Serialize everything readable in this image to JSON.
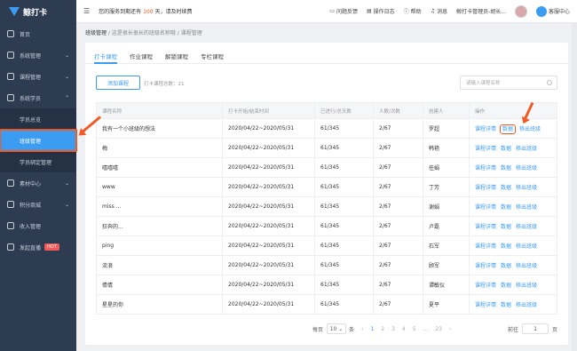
{
  "app": {
    "name": "鲸打卡"
  },
  "topbar": {
    "notice_prefix": "您的服务到期还有",
    "notice_days": "100",
    "notice_suffix": "天，请及时续费",
    "items": [
      "问题反馈",
      "操作日志",
      "帮助",
      "消息"
    ],
    "user": "鲸打卡管理员-胡长...",
    "service": "客服中心"
  },
  "sidebar": {
    "items": [
      {
        "label": "首页"
      },
      {
        "label": "系统管理"
      },
      {
        "label": "课程管理"
      },
      {
        "label": "系统学员"
      }
    ],
    "sub_items": [
      {
        "label": "学员总览"
      },
      {
        "label": "班级管理"
      },
      {
        "label": "学员绑定管理"
      }
    ],
    "items2": [
      {
        "label": "素材中心"
      },
      {
        "label": "积分商城"
      },
      {
        "label": "收入管理"
      },
      {
        "label": "发起直播"
      }
    ],
    "hot": "HOT"
  },
  "breadcrumb": {
    "root": "班级管理",
    "middle": "这是很长很长的班级名称哦",
    "current": "课程管理"
  },
  "tabs": [
    "打卡课程",
    "作业课程",
    "解锁课程",
    "专栏课程"
  ],
  "toolbar": {
    "add_label": "添加课程",
    "count_label": "打卡课程总数：21",
    "search_placeholder": "请输入课程名称"
  },
  "table": {
    "headers": [
      "课程名称",
      "打卡开始/结束时间",
      "已进行/总天数",
      "人数/次数",
      "创建人",
      "操作"
    ],
    "rows": [
      {
        "name": "我有一个小班级的想法",
        "time": "2020/04/22~2020/05/31",
        "days": "61/345",
        "count": "2/67",
        "creator": "罗超"
      },
      {
        "name": "梅",
        "time": "2020/04/22~2020/05/31",
        "days": "61/345",
        "count": "2/67",
        "creator": "韩艳"
      },
      {
        "name": "嘻嘻嘻",
        "time": "2020/04/22~2020/05/31",
        "days": "61/345",
        "count": "2/67",
        "creator": "任娟"
      },
      {
        "name": "www",
        "time": "2020/04/22~2020/05/31",
        "days": "61/345",
        "count": "2/67",
        "creator": "丁芳"
      },
      {
        "name": "miss ...",
        "time": "2020/04/22~2020/05/31",
        "days": "61/345",
        "count": "2/67",
        "creator": "谢娟"
      },
      {
        "name": "狂奔的...",
        "time": "2020/04/22~2020/05/31",
        "days": "61/345",
        "count": "2/67",
        "creator": "卢磊"
      },
      {
        "name": "ping",
        "time": "2020/04/22~2020/05/31",
        "days": "61/345",
        "count": "2/67",
        "creator": "石军"
      },
      {
        "name": "流浪",
        "time": "2020/04/22~2020/05/31",
        "days": "61/345",
        "count": "2/67",
        "creator": "顾军"
      },
      {
        "name": "倩倩",
        "time": "2020/04/22~2020/05/31",
        "days": "61/345",
        "count": "2/67",
        "creator": "谭敏仪"
      },
      {
        "name": "星星的你",
        "time": "2020/04/22~2020/05/31",
        "days": "61/345",
        "count": "2/67",
        "creator": "夏平"
      }
    ],
    "ops": [
      "课程详情",
      "数据",
      "移出班级"
    ]
  },
  "pager": {
    "per_label": "每页",
    "per_value": "10",
    "per_unit": "条",
    "pages": [
      "1",
      "2",
      "3",
      "4",
      "5",
      "...",
      "23"
    ],
    "goto_label": "前往",
    "goto_value": "1",
    "goto_unit": "页"
  },
  "colors": {
    "accent": "#3c9cf2",
    "highlight": "#f15a24",
    "sidebar": "#2e3c52"
  }
}
